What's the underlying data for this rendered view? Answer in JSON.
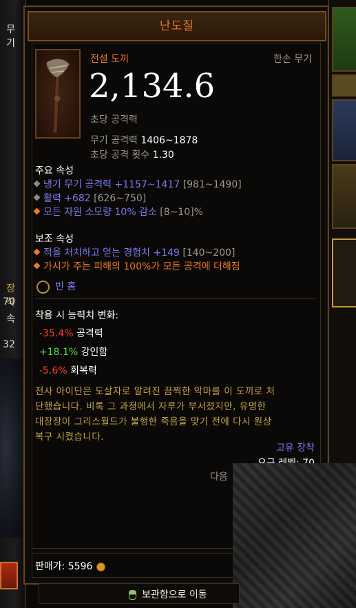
{
  "left_panel": {
    "texts": [
      "무기",
      "장착",
      "70",
      "속",
      "32"
    ]
  },
  "tooltip": {
    "title": "난도질",
    "item_type": "전설 도끼",
    "slot_type": "한손 무기",
    "dps_value": "2,134.6",
    "dps_label": "초당 공격력",
    "weapon_damage_label": "무기 공격력",
    "weapon_damage_value": "1406~1878",
    "attack_speed_label": "초당 공격 횟수",
    "attack_speed_value": "1.30",
    "primary_header": "주요 속성",
    "primary": [
      {
        "text": "냉기 무기 공격력 +1157~1417",
        "range": "[981~1490]",
        "bullet": "grey"
      },
      {
        "text": "활력 +682",
        "range": "[626~750]",
        "bullet": "grey"
      },
      {
        "text": "모든 자원 소모량 10% 감소",
        "range": "[8~10]%",
        "bullet": "orange"
      }
    ],
    "secondary_header": "보조 속성",
    "secondary": [
      {
        "text": "적을 처치하고 얻는 경험치 +149",
        "range": "[140~200]",
        "style": "blue"
      },
      {
        "text": "가시가 주는 피해의 100%가 모든 공격에 더해짐",
        "range": "",
        "style": "orange"
      }
    ],
    "socket_label": "빈 홈",
    "change_header": "착용 시 능력치 변화:",
    "changes": [
      {
        "value": "-35.4%",
        "stat": "공격력",
        "color": "red"
      },
      {
        "value": "+18.1%",
        "stat": "강인함",
        "color": "green"
      },
      {
        "value": "-5.6%",
        "stat": "회복력",
        "color": "red"
      }
    ],
    "flavor_lines": [
      "전사 아이단은 도살자로 알려진 끔찍한 악마를 이 도끼로 처",
      "단했습니다. 비록 그 과정에서 자루가 부서졌지만, 유명한",
      "대장장이 그리스월드가 불행한 죽음을 맞기 전에 다시 원상",
      "복구 시켰습니다."
    ],
    "unique_equip": "고유 장착",
    "req_level_label": "요구 레벨: 70",
    "next_label": "다음",
    "sell_price_label": "판매가: 5596"
  },
  "bottom_bar": {
    "label": "보관함으로 이동"
  }
}
